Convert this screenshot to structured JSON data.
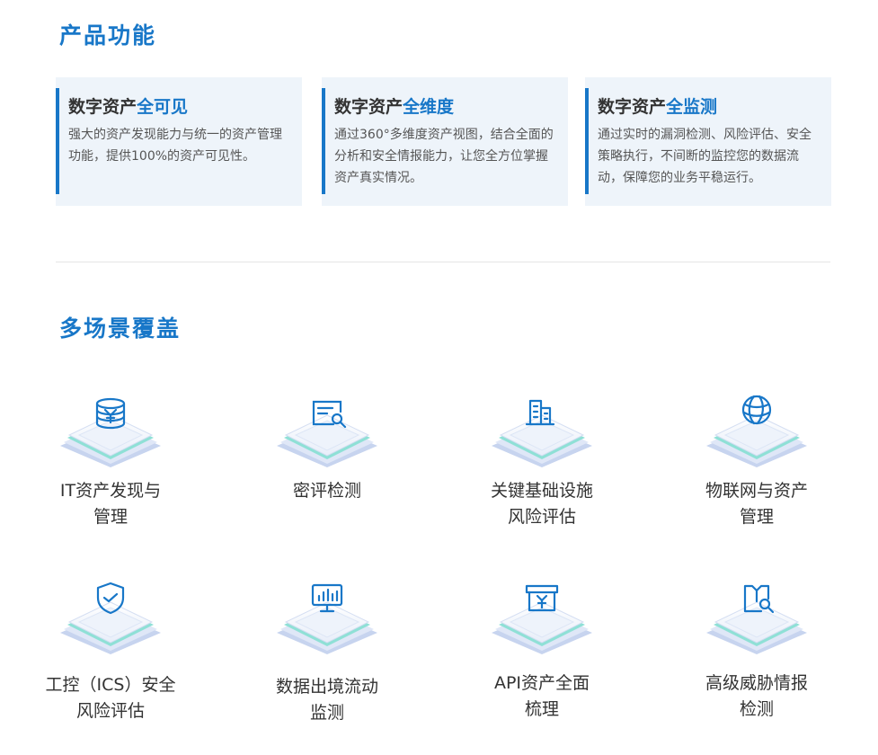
{
  "sections": {
    "features_title": "产品功能",
    "scenes_title": "多场景覆盖"
  },
  "features": [
    {
      "title_prefix": "数字资产",
      "title_highlight": "全可见",
      "desc": "强大的资产发现能力与统一的资产管理功能，提供100%的资产可见性。"
    },
    {
      "title_prefix": "数字资产",
      "title_highlight": "全维度",
      "desc": "通过360°多维度资产视图，结合全面的分析和安全情报能力，让您全方位掌握资产真实情况。"
    },
    {
      "title_prefix": "数字资产",
      "title_highlight": "全监测",
      "desc": "通过实时的漏洞检测、风险评估、安全策略执行，不间断的监控您的数据流动，保障您的业务平稳运行。"
    }
  ],
  "scenes": [
    {
      "line1": "IT资产发现与",
      "line2": "管理",
      "icon": "database-yen-icon"
    },
    {
      "line1": "密评检测",
      "line2": "",
      "icon": "document-search-icon"
    },
    {
      "line1": "关键基础设施",
      "line2": "风险评估",
      "icon": "building-icon"
    },
    {
      "line1": "物联网与资产",
      "line2": "管理",
      "icon": "globe-icon"
    },
    {
      "line1": "工控（ICS）安全",
      "line2": "风险评估",
      "icon": "shield-check-icon"
    },
    {
      "line1": "数据出境流动",
      "line2": "监测",
      "icon": "monitor-chart-icon"
    },
    {
      "line1": "API资产全面",
      "line2": "梳理",
      "icon": "archive-yen-icon"
    },
    {
      "line1": "高级威胁情报",
      "line2": "检测",
      "icon": "book-search-icon"
    }
  ],
  "colors": {
    "accent": "#1877c8",
    "card_bg": "#eef4fa",
    "platform_top": "#f3f6fc",
    "platform_edge": "#c9d5ee",
    "platform_teal": "#8fe0d6"
  }
}
